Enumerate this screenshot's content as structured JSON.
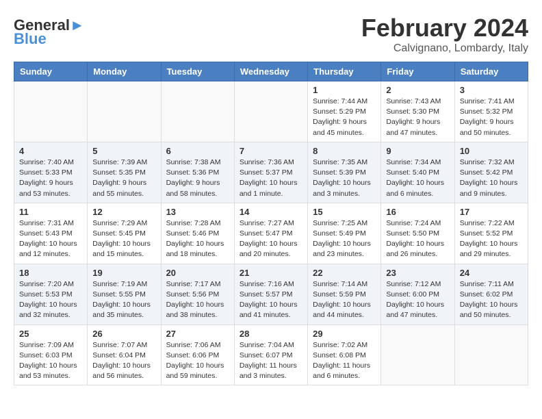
{
  "header": {
    "logo_line1": "General",
    "logo_line2": "Blue",
    "month_year": "February 2024",
    "location": "Calvignano, Lombardy, Italy"
  },
  "weekdays": [
    "Sunday",
    "Monday",
    "Tuesday",
    "Wednesday",
    "Thursday",
    "Friday",
    "Saturday"
  ],
  "weeks": [
    [
      {
        "day": "",
        "info": ""
      },
      {
        "day": "",
        "info": ""
      },
      {
        "day": "",
        "info": ""
      },
      {
        "day": "",
        "info": ""
      },
      {
        "day": "1",
        "info": "Sunrise: 7:44 AM\nSunset: 5:29 PM\nDaylight: 9 hours\nand 45 minutes."
      },
      {
        "day": "2",
        "info": "Sunrise: 7:43 AM\nSunset: 5:30 PM\nDaylight: 9 hours\nand 47 minutes."
      },
      {
        "day": "3",
        "info": "Sunrise: 7:41 AM\nSunset: 5:32 PM\nDaylight: 9 hours\nand 50 minutes."
      }
    ],
    [
      {
        "day": "4",
        "info": "Sunrise: 7:40 AM\nSunset: 5:33 PM\nDaylight: 9 hours\nand 53 minutes."
      },
      {
        "day": "5",
        "info": "Sunrise: 7:39 AM\nSunset: 5:35 PM\nDaylight: 9 hours\nand 55 minutes."
      },
      {
        "day": "6",
        "info": "Sunrise: 7:38 AM\nSunset: 5:36 PM\nDaylight: 9 hours\nand 58 minutes."
      },
      {
        "day": "7",
        "info": "Sunrise: 7:36 AM\nSunset: 5:37 PM\nDaylight: 10 hours\nand 1 minute."
      },
      {
        "day": "8",
        "info": "Sunrise: 7:35 AM\nSunset: 5:39 PM\nDaylight: 10 hours\nand 3 minutes."
      },
      {
        "day": "9",
        "info": "Sunrise: 7:34 AM\nSunset: 5:40 PM\nDaylight: 10 hours\nand 6 minutes."
      },
      {
        "day": "10",
        "info": "Sunrise: 7:32 AM\nSunset: 5:42 PM\nDaylight: 10 hours\nand 9 minutes."
      }
    ],
    [
      {
        "day": "11",
        "info": "Sunrise: 7:31 AM\nSunset: 5:43 PM\nDaylight: 10 hours\nand 12 minutes."
      },
      {
        "day": "12",
        "info": "Sunrise: 7:29 AM\nSunset: 5:45 PM\nDaylight: 10 hours\nand 15 minutes."
      },
      {
        "day": "13",
        "info": "Sunrise: 7:28 AM\nSunset: 5:46 PM\nDaylight: 10 hours\nand 18 minutes."
      },
      {
        "day": "14",
        "info": "Sunrise: 7:27 AM\nSunset: 5:47 PM\nDaylight: 10 hours\nand 20 minutes."
      },
      {
        "day": "15",
        "info": "Sunrise: 7:25 AM\nSunset: 5:49 PM\nDaylight: 10 hours\nand 23 minutes."
      },
      {
        "day": "16",
        "info": "Sunrise: 7:24 AM\nSunset: 5:50 PM\nDaylight: 10 hours\nand 26 minutes."
      },
      {
        "day": "17",
        "info": "Sunrise: 7:22 AM\nSunset: 5:52 PM\nDaylight: 10 hours\nand 29 minutes."
      }
    ],
    [
      {
        "day": "18",
        "info": "Sunrise: 7:20 AM\nSunset: 5:53 PM\nDaylight: 10 hours\nand 32 minutes."
      },
      {
        "day": "19",
        "info": "Sunrise: 7:19 AM\nSunset: 5:55 PM\nDaylight: 10 hours\nand 35 minutes."
      },
      {
        "day": "20",
        "info": "Sunrise: 7:17 AM\nSunset: 5:56 PM\nDaylight: 10 hours\nand 38 minutes."
      },
      {
        "day": "21",
        "info": "Sunrise: 7:16 AM\nSunset: 5:57 PM\nDaylight: 10 hours\nand 41 minutes."
      },
      {
        "day": "22",
        "info": "Sunrise: 7:14 AM\nSunset: 5:59 PM\nDaylight: 10 hours\nand 44 minutes."
      },
      {
        "day": "23",
        "info": "Sunrise: 7:12 AM\nSunset: 6:00 PM\nDaylight: 10 hours\nand 47 minutes."
      },
      {
        "day": "24",
        "info": "Sunrise: 7:11 AM\nSunset: 6:02 PM\nDaylight: 10 hours\nand 50 minutes."
      }
    ],
    [
      {
        "day": "25",
        "info": "Sunrise: 7:09 AM\nSunset: 6:03 PM\nDaylight: 10 hours\nand 53 minutes."
      },
      {
        "day": "26",
        "info": "Sunrise: 7:07 AM\nSunset: 6:04 PM\nDaylight: 10 hours\nand 56 minutes."
      },
      {
        "day": "27",
        "info": "Sunrise: 7:06 AM\nSunset: 6:06 PM\nDaylight: 10 hours\nand 59 minutes."
      },
      {
        "day": "28",
        "info": "Sunrise: 7:04 AM\nSunset: 6:07 PM\nDaylight: 11 hours\nand 3 minutes."
      },
      {
        "day": "29",
        "info": "Sunrise: 7:02 AM\nSunset: 6:08 PM\nDaylight: 11 hours\nand 6 minutes."
      },
      {
        "day": "",
        "info": ""
      },
      {
        "day": "",
        "info": ""
      }
    ]
  ]
}
